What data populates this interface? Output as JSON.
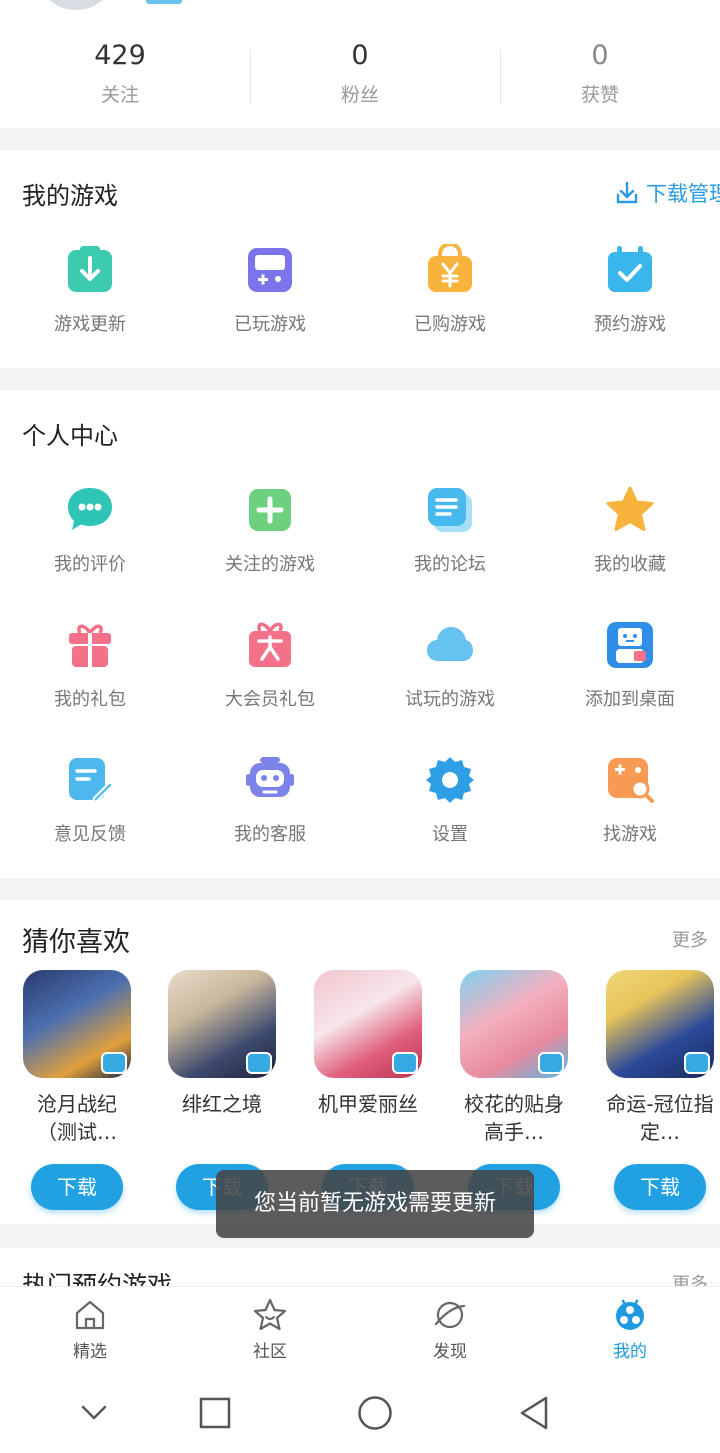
{
  "stats": [
    {
      "value": "429",
      "label": "关注"
    },
    {
      "value": "0",
      "label": "粉丝"
    },
    {
      "value": "0",
      "label": "获赞"
    }
  ],
  "my_games": {
    "title": "我的游戏",
    "download_manage": "下载管理",
    "items": [
      {
        "label": "游戏更新",
        "icon": "game-update-icon",
        "color": "#3ccab0"
      },
      {
        "label": "已玩游戏",
        "icon": "gamepad-icon",
        "color": "#7c74ea"
      },
      {
        "label": "已购游戏",
        "icon": "shopping-bag-yen-icon",
        "color": "#f7b33b"
      },
      {
        "label": "预约游戏",
        "icon": "calendar-check-icon",
        "color": "#39b7ec"
      }
    ]
  },
  "personal_center": {
    "title": "个人中心",
    "items": [
      {
        "label": "我的评价",
        "icon": "chat-bubble-icon",
        "color": "#2ec4b6"
      },
      {
        "label": "关注的游戏",
        "icon": "plus-square-icon",
        "color": "#6dd07f"
      },
      {
        "label": "我的论坛",
        "icon": "forum-icon",
        "color": "#46b9ee"
      },
      {
        "label": "我的收藏",
        "icon": "star-icon",
        "color": "#f7b33b"
      },
      {
        "label": "我的礼包",
        "icon": "gift-icon",
        "color": "#f4718a"
      },
      {
        "label": "大会员礼包",
        "icon": "vip-gift-icon",
        "color": "#f4718a"
      },
      {
        "label": "试玩的游戏",
        "icon": "cloud-icon",
        "color": "#66c3ef"
      },
      {
        "label": "添加到桌面",
        "icon": "bilibili-tv-icon",
        "color": "#2f8fe8"
      },
      {
        "label": "意见反馈",
        "icon": "feedback-edit-icon",
        "color": "#4cb8ee"
      },
      {
        "label": "我的客服",
        "icon": "robot-icon",
        "color": "#7c83ea"
      },
      {
        "label": "设置",
        "icon": "gear-icon",
        "color": "#2f9fe5"
      },
      {
        "label": "找游戏",
        "icon": "search-game-icon",
        "color": "#f79a54"
      }
    ]
  },
  "guess_you_like": {
    "title": "猜你喜欢",
    "more": "更多",
    "download_label": "下载",
    "games": [
      {
        "name": "沧月战纪（测试…"
      },
      {
        "name": "绯红之境"
      },
      {
        "name": "机甲爱丽丝"
      },
      {
        "name": "校花的贴身高手…"
      },
      {
        "name": "命运-冠位指定…"
      }
    ]
  },
  "toast": "您当前暂无游戏需要更新",
  "hot_reserve": {
    "title": "热门预约游戏",
    "more": "更多"
  },
  "tabs": [
    {
      "label": "精选",
      "icon": "home-icon"
    },
    {
      "label": "社区",
      "icon": "star-face-icon"
    },
    {
      "label": "发现",
      "icon": "planet-icon"
    },
    {
      "label": "我的",
      "icon": "bilibili-me-icon",
      "active": true
    }
  ],
  "colors": {
    "accent": "#21a1e1",
    "active_tab": "#1d9ae0"
  }
}
